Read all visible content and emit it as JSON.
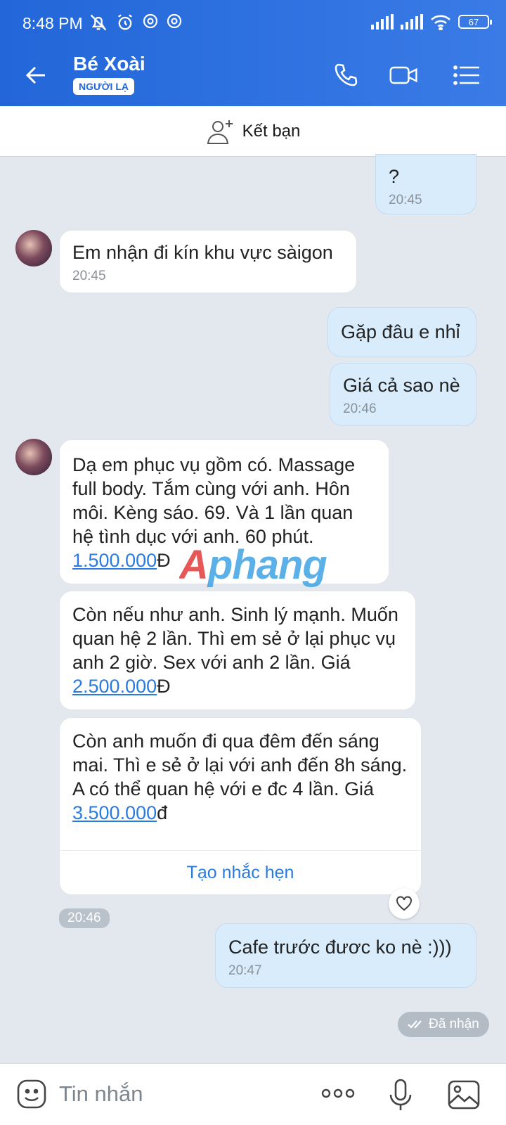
{
  "status_bar": {
    "time": "8:48 PM",
    "battery": "67"
  },
  "header": {
    "name": "Bé Xoài",
    "badge": "NGƯỜI LẠ"
  },
  "add_friend": {
    "label": "Kết bạn"
  },
  "messages": [
    {
      "dir": "out",
      "text": "?",
      "time": "20:45"
    },
    {
      "dir": "in",
      "text": "Em nhận đi kín khu vực sàigon",
      "time": "20:45"
    },
    {
      "dir": "out",
      "text": "Gặp đâu e nhỉ"
    },
    {
      "dir": "out",
      "text": "Giá cả sao nè",
      "time": "20:46"
    },
    {
      "dir": "in",
      "text": "Dạ em phục vụ gồm có. Massage full body. Tắm cùng với anh. Hôn môi. Kèng sáo. 69. Và 1  lần quan hệ tình dục với anh. 60 phút.",
      "price": "1.500.000",
      "suffix": "Đ"
    },
    {
      "dir": "in",
      "text": "Còn nếu như anh. Sinh lý mạnh. Muốn quan hệ 2 lần. Thì em sẻ ở lại phục vụ anh 2 giờ.  Sex với anh 2 lần. Giá ",
      "price": "2.500.000",
      "suffix": "Đ"
    },
    {
      "dir": "in",
      "text": "Còn anh muốn đi qua đêm đến sáng mai.  Thì e sẻ ở lại với anh đến 8h sáng. A có thể quan hệ với e đc 4 lần. Giá ",
      "price": "3.500.000",
      "suffix": "đ"
    },
    {
      "dir": "out",
      "text": "Cafe trước đươc ko nè :)))",
      "time": "20:47"
    }
  ],
  "reminder_label": "Tạo nhắc hẹn",
  "group_time": "20:46",
  "received_label": "Đã nhận",
  "watermark": "Aphang",
  "input": {
    "placeholder": "Tin nhắn"
  }
}
